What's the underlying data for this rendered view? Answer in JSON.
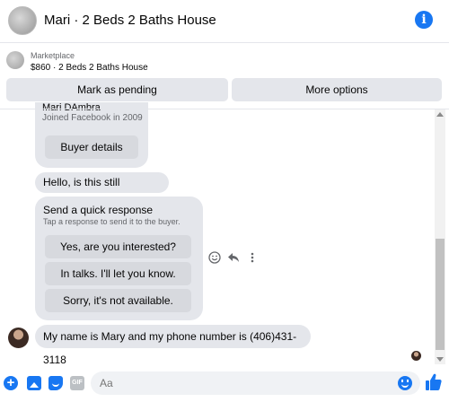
{
  "header": {
    "title": "Mari · 2 Beds 2 Baths House",
    "info_icon": "info-icon",
    "info_glyph": "i"
  },
  "listing": {
    "source": "Marketplace",
    "price_title": "$860 · 2 Beds 2 Baths House",
    "mark_pending_label": "Mark as pending",
    "more_options_label": "More options"
  },
  "buyer_card": {
    "name": "Mari DAmbra",
    "joined": "Joined Facebook in 2009",
    "buyer_details_label": "Buyer details"
  },
  "messages": {
    "hello": "Hello, is this still available?",
    "phone": "My name is Mary and my phone number is (406)431-3118"
  },
  "quick_response": {
    "title": "Send a quick response",
    "subtitle": "Tap a response to send it to the buyer.",
    "options": [
      "Yes, are you interested?",
      "In talks. I'll let you know.",
      "Sorry, it's not available."
    ]
  },
  "message_actions": {
    "react_icon": "smiley-icon",
    "reply_icon": "reply-icon",
    "more_icon": "more-vertical-icon"
  },
  "composer": {
    "placeholder": "Aa",
    "plus_glyph": "+",
    "gif_label": "GIF",
    "icons": [
      "plus-icon",
      "photo-icon",
      "sticker-icon",
      "gif-icon",
      "emoji-icon",
      "like-icon"
    ]
  },
  "colors": {
    "accent": "#1877f2",
    "bubble": "#e4e6eb",
    "secondary_text": "#65676b"
  }
}
